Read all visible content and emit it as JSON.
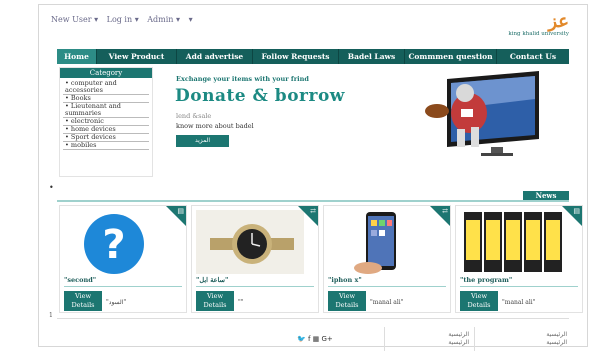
{
  "topbar": {
    "new_user": "New User ▾",
    "login": "Log in ▾",
    "admin": "Admin ▾",
    "extra": "▾"
  },
  "logo": {
    "university": "king khalid university"
  },
  "nav": [
    "Home",
    "View Product",
    "Add advertise",
    "Follow Requests",
    "Badel Laws",
    "Commmen question",
    "Contact Us"
  ],
  "category": {
    "title": "Category",
    "items": [
      "• computer and accessories",
      "• Books",
      "• Lieutenant and summaries",
      "• electronic",
      "• home devices",
      "• Sport devices",
      "• mobiles"
    ]
  },
  "hero": {
    "tagline": "Exchange your items with your frind",
    "title": "Donate & borrow",
    "subtitle": "lend &sale",
    "more": "know more about badel",
    "button": "المزيد"
  },
  "news_label": "News",
  "cards": [
    {
      "title": "\"second\"",
      "button": "View Details",
      "owner": "\"السود\""
    },
    {
      "title": "\"ساعة ابل\"",
      "button": "View Details",
      "owner": "\"\""
    },
    {
      "title": "\"iphon x\"",
      "button": "View Details",
      "owner": "\"manal ali\""
    },
    {
      "title": "\"the program\"",
      "button": "View Details",
      "owner": "\"manal ali\""
    }
  ],
  "footer": {
    "social": "🐦 f ▦ G+",
    "col1": [
      "الرئيسية",
      "الرئيسية"
    ],
    "col2": [
      "الرئيسية",
      "الرئيسية"
    ],
    "mark": "1"
  },
  "colors": {
    "primary": "#1c7671",
    "nav": "#155f5b",
    "accent": "#e2892b"
  }
}
